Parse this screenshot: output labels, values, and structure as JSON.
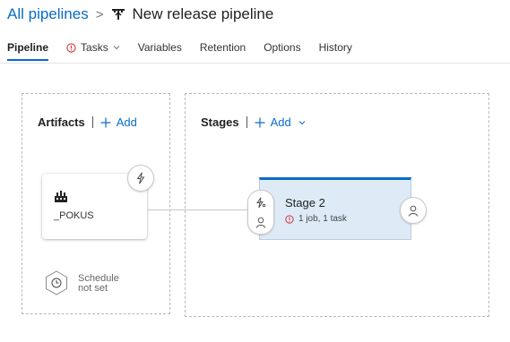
{
  "header": {
    "breadcrumb_root": "All pipelines",
    "separator": ">",
    "pipeline_name": "New release pipeline"
  },
  "tabs": [
    {
      "label": "Pipeline",
      "active": true
    },
    {
      "label": "Tasks",
      "has_warning": true,
      "has_dropdown": true
    },
    {
      "label": "Variables"
    },
    {
      "label": "Retention"
    },
    {
      "label": "Options"
    },
    {
      "label": "History"
    }
  ],
  "artifacts": {
    "title": "Artifacts",
    "add_label": "Add",
    "items": [
      {
        "name": "_POKUS",
        "icon": "build-factory-icon"
      }
    ]
  },
  "stages": {
    "title": "Stages",
    "add_label": "Add",
    "items": [
      {
        "name": "Stage 2",
        "status": "1 job, 1 task",
        "status_icon": "warning-icon"
      }
    ]
  },
  "schedule": {
    "line1": "Schedule",
    "line2": "not set"
  },
  "colors": {
    "accent": "#0b6cc8",
    "stage_bg": "#deebf7",
    "warning": "#d13438"
  }
}
